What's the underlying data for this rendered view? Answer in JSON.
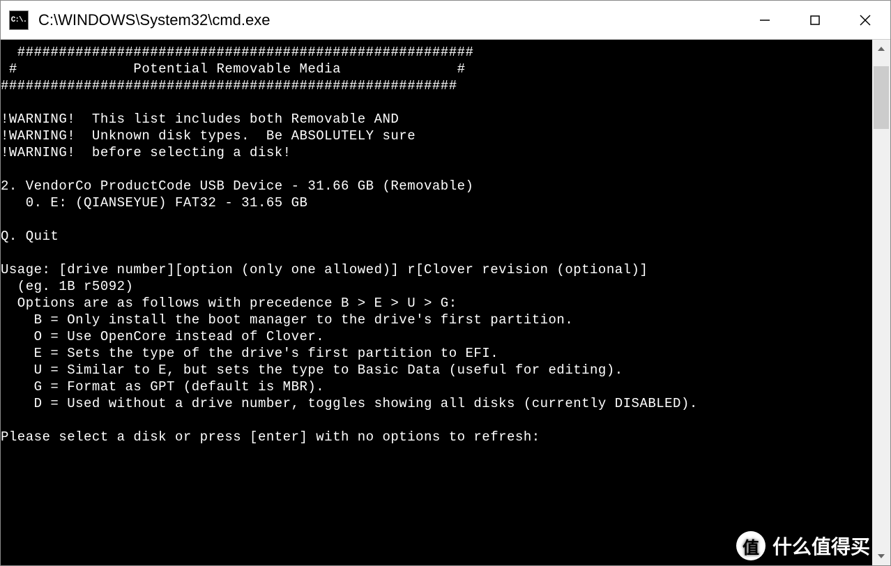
{
  "window": {
    "title": "C:\\WINDOWS\\System32\\cmd.exe",
    "icon_label": "C:\\."
  },
  "terminal": {
    "lines": [
      "  #######################################################",
      " #              Potential Removable Media              #",
      "#######################################################",
      "",
      "!WARNING!  This list includes both Removable AND",
      "!WARNING!  Unknown disk types.  Be ABSOLUTELY sure",
      "!WARNING!  before selecting a disk!",
      "",
      "2. VendorCo ProductCode USB Device - 31.66 GB (Removable)",
      "   0. E: (QIANSEYUE) FAT32 - 31.65 GB",
      "",
      "Q. Quit",
      "",
      "Usage: [drive number][option (only one allowed)] r[Clover revision (optional)]",
      "  (eg. 1B r5092)",
      "  Options are as follows with precedence B > E > U > G:",
      "    B = Only install the boot manager to the drive's first partition.",
      "    O = Use OpenCore instead of Clover.",
      "    E = Sets the type of the drive's first partition to EFI.",
      "    U = Similar to E, but sets the type to Basic Data (useful for editing).",
      "    G = Format as GPT (default is MBR).",
      "    D = Used without a drive number, toggles showing all disks (currently DISABLED).",
      "",
      "Please select a disk or press [enter] with no options to refresh:"
    ]
  },
  "watermark": {
    "badge": "值",
    "text": "什么值得买"
  }
}
